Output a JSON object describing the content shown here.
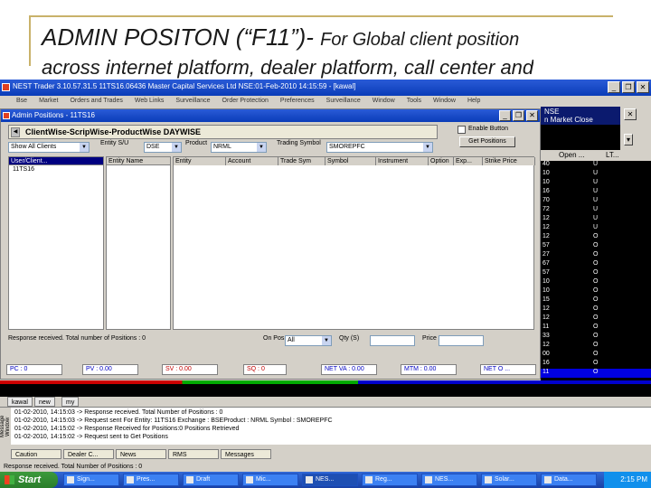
{
  "slide": {
    "title_main": "ADMIN POSITON (“F11”)- ",
    "title_sub": "For Global client position",
    "title_line2": "across internet platform, dealer platform, call center and"
  },
  "window": {
    "title": "NEST Trader 3.10.57.31.5 11TS16.06436 Master Capital Services Ltd NSE:01-Feb-2010 14:15:59 - [kawal]",
    "menu": [
      "Bse",
      "Market",
      "Orders and Trades",
      "Web Links",
      "Surveillance",
      "Order Protection",
      "Preferences",
      "Surveillance",
      "Window",
      "Tools",
      "Window",
      "Help"
    ]
  },
  "right_panel": {
    "banner_line1": "NSE",
    "banner_line2": "n Market Close",
    "col_open": "Open ...",
    "col_lt": "LT...",
    "rows": [
      {
        "a": "40",
        "b": "U"
      },
      {
        "a": "10",
        "b": "U"
      },
      {
        "a": "10",
        "b": "U"
      },
      {
        "a": "16",
        "b": "U"
      },
      {
        "a": "70",
        "b": "U"
      },
      {
        "a": "72",
        "b": "U"
      },
      {
        "a": "12",
        "b": "U"
      },
      {
        "a": "12",
        "b": "U"
      },
      {
        "a": "12",
        "b": "O"
      },
      {
        "a": "57",
        "b": "O"
      },
      {
        "a": "27",
        "b": "O"
      },
      {
        "a": "67",
        "b": "O"
      },
      {
        "a": "57",
        "b": "O"
      },
      {
        "a": "10",
        "b": "O"
      },
      {
        "a": "10",
        "b": "O"
      },
      {
        "a": "15",
        "b": "O"
      },
      {
        "a": "12",
        "b": "O"
      },
      {
        "a": "12",
        "b": "O"
      },
      {
        "a": "11",
        "b": "O"
      },
      {
        "a": "33",
        "b": "O"
      },
      {
        "a": "12",
        "b": "O"
      },
      {
        "a": "00",
        "b": "O"
      },
      {
        "a": "16",
        "b": "O"
      },
      {
        "a": "11",
        "b": "O"
      }
    ]
  },
  "admin": {
    "title": "Admin Positions - 11TS16",
    "tab_label": "ClientWise-ScripWise-ProductWise  DAYWISE",
    "enable_button_label": "Enable Button",
    "get_positions_label": "Get Positions",
    "show_label": "Show All Clients",
    "entity_label": "Entity S/U",
    "entity_value": "DSE",
    "product_label": "Product",
    "product_value": "NRML",
    "trading_symbol_label": "Trading Symbol",
    "trading_symbol_value": "SMOREPFC",
    "left_list_header": "User/Client...",
    "left_list_item": "11TS16",
    "mid_list_header": "Entity Name",
    "columns": [
      "Entity",
      "Account",
      "Trade Sym",
      "Symbol",
      "Instrument",
      "Option",
      "Exp...",
      "Strike Price"
    ],
    "response_text": "Response received. Total number of Positions : 0",
    "filter_label": "On Pos",
    "filter_value": "All",
    "qty_label": "Qty (S)",
    "price_label": "Price",
    "stats": [
      {
        "label": "PC : 0"
      },
      {
        "label": "PV : 0.00"
      },
      {
        "label": "SV : 0.00"
      },
      {
        "label": "SQ : 0"
      },
      {
        "label": "NET VA : 0.00"
      },
      {
        "label": "MTM : 0.00"
      },
      {
        "label": "NET O ..."
      }
    ]
  },
  "tabs2": [
    "kawal",
    "new",
    "my"
  ],
  "messages": {
    "side_label": "Message Window",
    "lines": [
      "01-02-2010, 14:15:03  ->  Response received. Total Number of Positions : 0",
      "01-02-2010, 14:15:03  ->  Request sent For Entity: 11TS16 Exchange : BSEProduct : NRML Symbol : SMOREPFC",
      "01-02-2010, 14:15:02  ->  Response Received for Positions:0 Positions Retrieved",
      "01-02-2010, 14:15:02  ->  Request sent to Get Positions"
    ]
  },
  "bottom_tabs": [
    "Caution",
    "Dealer C...",
    "News",
    "RMS",
    "Messages"
  ],
  "status_text": "Response received. Total Number of Positions : 0",
  "taskbar": {
    "start": "Start",
    "items": [
      "Sign...",
      "Pres...",
      "Draft",
      "Mic...",
      "NES...",
      "Reg...",
      "NES...",
      "Solar...",
      "Data..."
    ],
    "clock": "2:15 PM"
  }
}
